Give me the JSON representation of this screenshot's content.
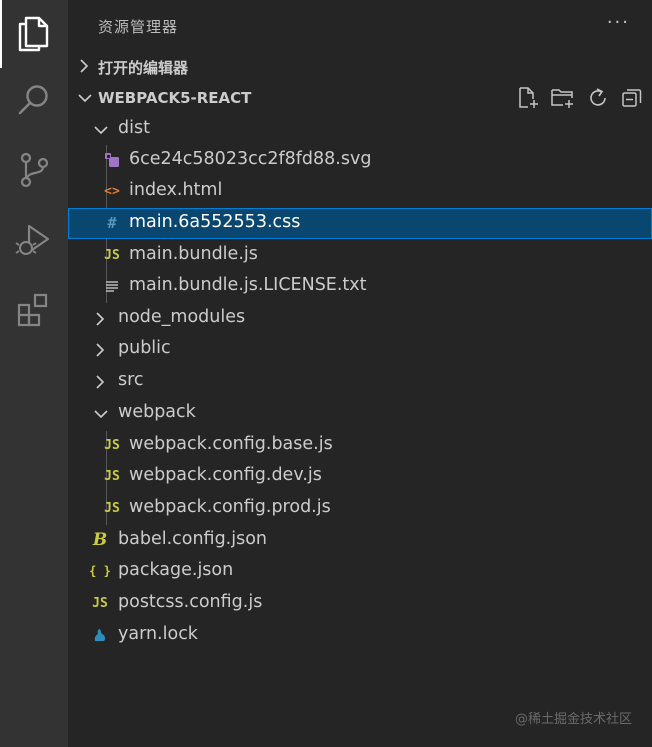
{
  "sidebar": {
    "title": "资源管理器",
    "more_actions": "···"
  },
  "open_editors": {
    "label": "打开的编辑器"
  },
  "project": {
    "label": "WEBPACK5-REACT"
  },
  "tree": {
    "items": [
      {
        "label": "dist",
        "kind": "folder",
        "expanded": true
      },
      {
        "label": "6ce24c58023cc2f8fd88.svg",
        "kind": "svg-file"
      },
      {
        "label": "index.html",
        "kind": "html-file",
        "glyph": "<>",
        "color": "#e37933"
      },
      {
        "label": "main.6a552553.css",
        "kind": "css-file",
        "glyph": "#",
        "color": "#519aba",
        "selected": true
      },
      {
        "label": "main.bundle.js",
        "kind": "js-file",
        "glyph": "JS",
        "color": "#cbcb41"
      },
      {
        "label": "main.bundle.js.LICENSE.txt",
        "kind": "text-file"
      },
      {
        "label": "node_modules",
        "kind": "folder",
        "expanded": false
      },
      {
        "label": "public",
        "kind": "folder",
        "expanded": false
      },
      {
        "label": "src",
        "kind": "folder",
        "expanded": false
      },
      {
        "label": "webpack",
        "kind": "folder",
        "expanded": true
      },
      {
        "label": "webpack.config.base.js",
        "kind": "js-file",
        "glyph": "JS",
        "color": "#cbcb41"
      },
      {
        "label": "webpack.config.dev.js",
        "kind": "js-file",
        "glyph": "JS",
        "color": "#cbcb41"
      },
      {
        "label": "webpack.config.prod.js",
        "kind": "js-file",
        "glyph": "JS",
        "color": "#cbcb41"
      },
      {
        "label": "babel.config.json",
        "kind": "babel-file",
        "glyph": "B",
        "color": "#cbcb41"
      },
      {
        "label": "package.json",
        "kind": "json-file",
        "glyph": "{ }",
        "color": "#cbcb41"
      },
      {
        "label": "postcss.config.js",
        "kind": "js-file",
        "glyph": "JS",
        "color": "#cbcb41"
      },
      {
        "label": "yarn.lock",
        "kind": "yarn-file",
        "color": "#2c8ebb"
      }
    ]
  },
  "watermark": "@稀土掘金技术社区",
  "colors": {
    "selection_bg": "#094771",
    "selection_border": "#007fd4",
    "svg_icon": "#a074c4"
  }
}
